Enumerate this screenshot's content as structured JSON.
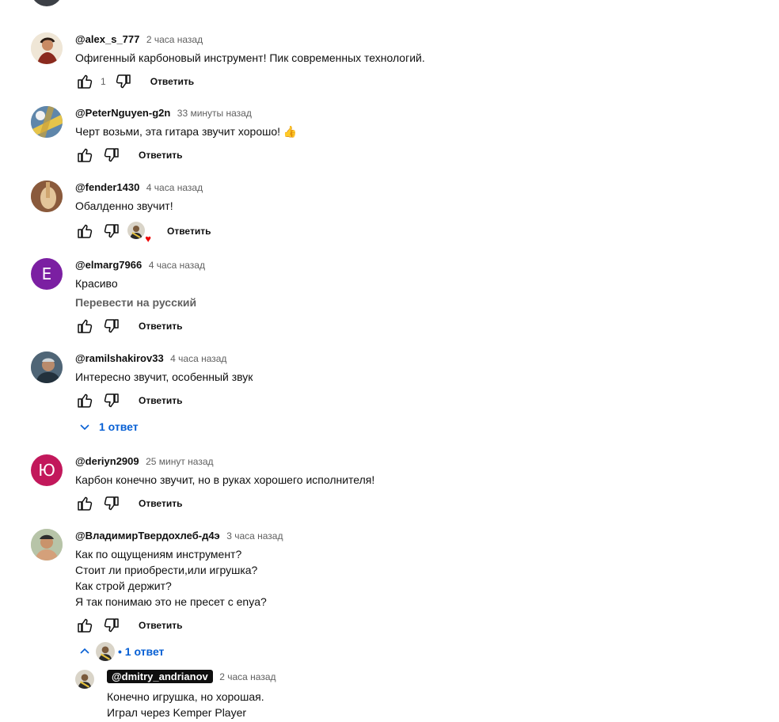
{
  "comments": [
    {
      "author": "@alex_s_777",
      "time": "2 часа назад",
      "text": [
        "Офигенный карбоновый инструмент! Пик современных технологий."
      ],
      "likes": "1",
      "reply_label": "Ответить"
    },
    {
      "author": "@PeterNguyen-g2n",
      "time": "33 минуты назад",
      "text": [
        "Черт возьми, эта гитара звучит хорошо! 👍"
      ],
      "likes": "",
      "reply_label": "Ответить"
    },
    {
      "author": "@fender1430",
      "time": "4 часа назад",
      "text": [
        "Обалденно звучит!"
      ],
      "likes": "",
      "creator_heart": true,
      "reply_label": "Ответить"
    },
    {
      "author": "@elmarg7966",
      "avatar_letter": "E",
      "avatar_color": "#7b1fa2",
      "time": "4 часа назад",
      "text": [
        "Красиво"
      ],
      "translate_label": "Перевести на русский",
      "likes": "",
      "reply_label": "Ответить"
    },
    {
      "author": "@ramilshakirov33",
      "time": "4 часа назад",
      "text": [
        "Интересно звучит, особенный звук"
      ],
      "likes": "",
      "reply_label": "Ответить",
      "replies_toggle": "1 ответ"
    },
    {
      "author": "@deriyn2909",
      "avatar_letter": "Ю",
      "avatar_color": "#c2185b",
      "time": "25 минут назад",
      "text": [
        "Карбон конечно звучит, но в руках хорошего исполнителя!"
      ],
      "likes": "",
      "reply_label": "Ответить"
    },
    {
      "author": "@ВладимирТвердохлеб-д4э",
      "time": "3 часа назад",
      "text": [
        "Как по ощущениям инструмент?",
        "Стоит ли приобрести,или игрушка?",
        "Как строй держит?",
        "Я так понимаю это не пресет с enya?"
      ],
      "likes": "",
      "reply_label": "Ответить",
      "replies_toggle": "• 1 ответ"
    }
  ],
  "reply": {
    "author": "@dmitry_andrianov",
    "time": "2 часа назад",
    "text": [
      "Конечно игрушка, но хорошая.",
      "Играл через Kemper Player"
    ]
  },
  "colors": {
    "link_blue": "#065fd4",
    "heart_red": "#e00000"
  },
  "icons": {
    "like": "thumb-up-icon",
    "dislike": "thumb-down-icon",
    "expand": "chevron-down-icon",
    "collapse": "chevron-up-icon"
  }
}
